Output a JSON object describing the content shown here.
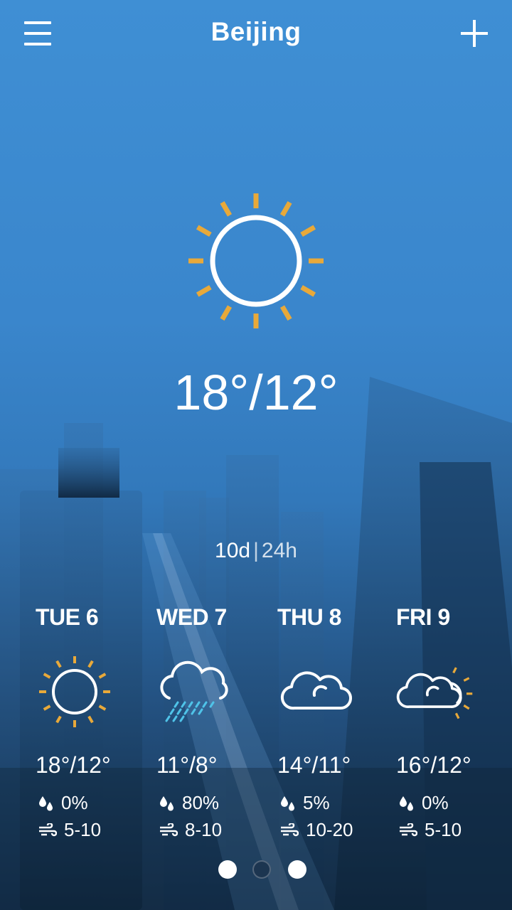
{
  "header": {
    "title": "Beijing"
  },
  "current": {
    "icon": "sun-icon",
    "temp": "18°/12°"
  },
  "view_toggle": {
    "option_1": "10d",
    "separator": "|",
    "option_2": "24h"
  },
  "forecast": [
    {
      "day": "TUE 6",
      "icon": "sun-icon",
      "temp": "18°/12°",
      "rain": "0%",
      "wind": "5-10"
    },
    {
      "day": "WED 7",
      "icon": "cloud-rain-icon",
      "temp": "11°/8°",
      "rain": "80%",
      "wind": "8-10"
    },
    {
      "day": "THU 8",
      "icon": "cloud-icon",
      "temp": "14°/11°",
      "rain": "5%",
      "wind": "10-20"
    },
    {
      "day": "FRI 9",
      "icon": "partly-cloudy-icon",
      "temp": "16°/12°",
      "rain": "0%",
      "wind": "5-10"
    }
  ],
  "pagination": {
    "pages": 3,
    "current": 2
  },
  "colors": {
    "sun_rays": "#e8a93a",
    "rain": "#4fc3e8",
    "accent": "#ffffff"
  }
}
